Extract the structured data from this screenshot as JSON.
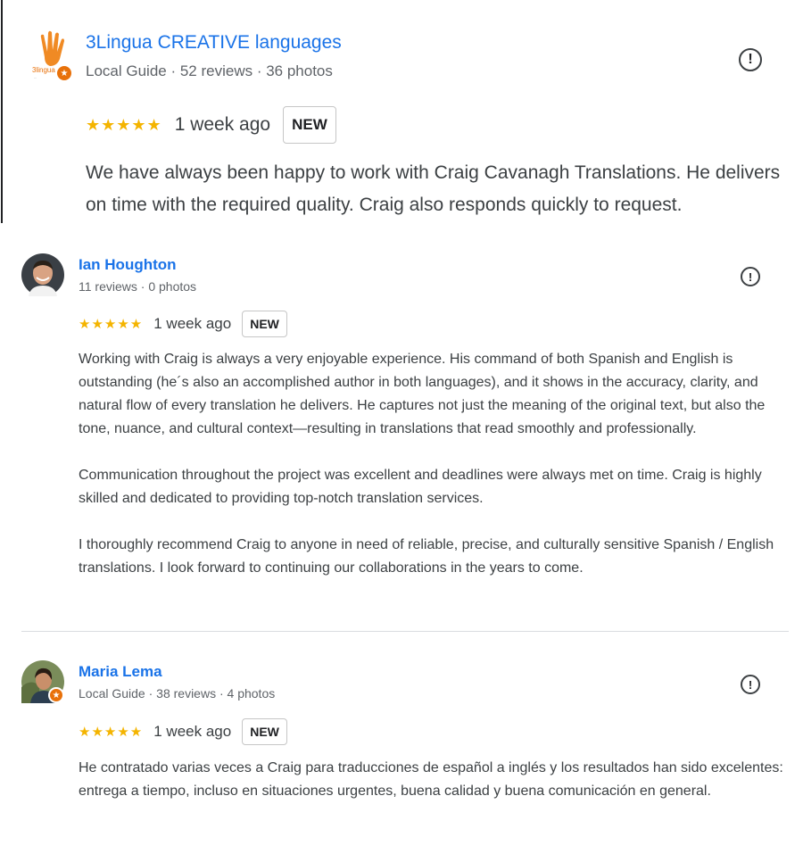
{
  "reviews": [
    {
      "author": "3Lingua CREATIVE languages",
      "meta": "Local Guide · 52 reviews · 36 photos",
      "stars": "★★★★★",
      "time": "1 week ago",
      "badge": "NEW",
      "logo_text": "3lingua",
      "paragraphs": [
        "We have always been happy to work with Craig Cavanagh Translations. He delivers on time with the required quality. Craig also responds quickly to request."
      ]
    },
    {
      "author": "Ian Houghton",
      "meta": "11 reviews · 0 photos",
      "stars": "★★★★★",
      "time": "1 week ago",
      "badge": "NEW",
      "paragraphs": [
        "Working with Craig is always a very enjoyable experience. His command of both Spanish and English is outstanding (he´s also an accomplished author in both languages), and it shows in the accuracy, clarity, and natural flow of every translation he delivers. He captures not just the meaning of the original text, but also the tone, nuance, and cultural context—resulting in translations that read smoothly and professionally.",
        "Communication throughout the project was excellent and deadlines were always met on time. Craig is highly skilled and dedicated to providing top-notch translation services.",
        "I thoroughly recommend Craig to anyone in need of reliable, precise, and culturally sensitive Spanish / English translations. I look forward to continuing our collaborations in the years to come."
      ]
    },
    {
      "author": "Maria Lema",
      "meta": "Local Guide · 38 reviews · 4 photos",
      "stars": "★★★★★",
      "time": "1 week ago",
      "badge": "NEW",
      "paragraphs": [
        "He contratado varias veces a Craig para traducciones de español a inglés y los resultados han sido excelentes: entrega a tiempo, incluso en situaciones urgentes, buena calidad y buena comunicación en general."
      ]
    }
  ],
  "icons": {
    "flag": "!",
    "local_guide_star": "★"
  },
  "colors": {
    "link": "#1a73e8",
    "star": "#f4b400",
    "guide_badge": "#e8710a"
  }
}
